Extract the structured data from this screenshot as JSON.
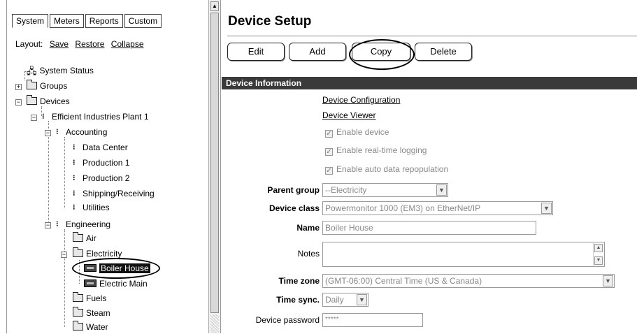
{
  "tabs": [
    "System",
    "Meters",
    "Reports",
    "Custom"
  ],
  "layout": {
    "label": "Layout:",
    "save": "Save",
    "restore": "Restore",
    "collapse": "Collapse"
  },
  "tree": {
    "system_status": "System Status",
    "groups": "Groups",
    "devices": "Devices",
    "plant": "Efficient Industries Plant 1",
    "accounting": "Accounting",
    "data_center": "Data Center",
    "production1": "Production 1",
    "production2": "Production 2",
    "shipping": "Shipping/Receiving",
    "utilities": "Utilities",
    "engineering": "Engineering",
    "air": "Air",
    "electricity": "Electricity",
    "boiler_house": "Boiler House",
    "electric_main": "Electric Main",
    "fuels": "Fuels",
    "steam": "Steam",
    "water": "Water"
  },
  "page": {
    "title": "Device Setup"
  },
  "buttons": {
    "edit": "Edit",
    "add": "Add",
    "copy": "Copy",
    "delete": "Delete"
  },
  "section": "Device Information",
  "links": {
    "config": "Device Configuration",
    "viewer": "Device Viewer"
  },
  "checks": {
    "enable_device": "Enable device",
    "realtime": "Enable real-time logging",
    "repopulate": "Enable auto data repopulation",
    "mark": "✓"
  },
  "fields": {
    "parent_group_label": "Parent group",
    "parent_group_value": "--Electricity",
    "device_class_label": "Device class",
    "device_class_value": "Powermonitor 1000 (EM3) on EtherNet/IP",
    "name_label": "Name",
    "name_value": "Boiler House",
    "notes_label": "Notes",
    "time_zone_label": "Time zone",
    "time_zone_value": "(GMT-06:00) Central Time (US & Canada)",
    "time_sync_label": "Time sync.",
    "time_sync_value": "Daily",
    "password_label": "Device password",
    "password_value": "*****"
  },
  "glyphs": {
    "plus": "+",
    "minus": "−",
    "down": "▼",
    "up": "▲",
    "scroll_up": "▲"
  }
}
